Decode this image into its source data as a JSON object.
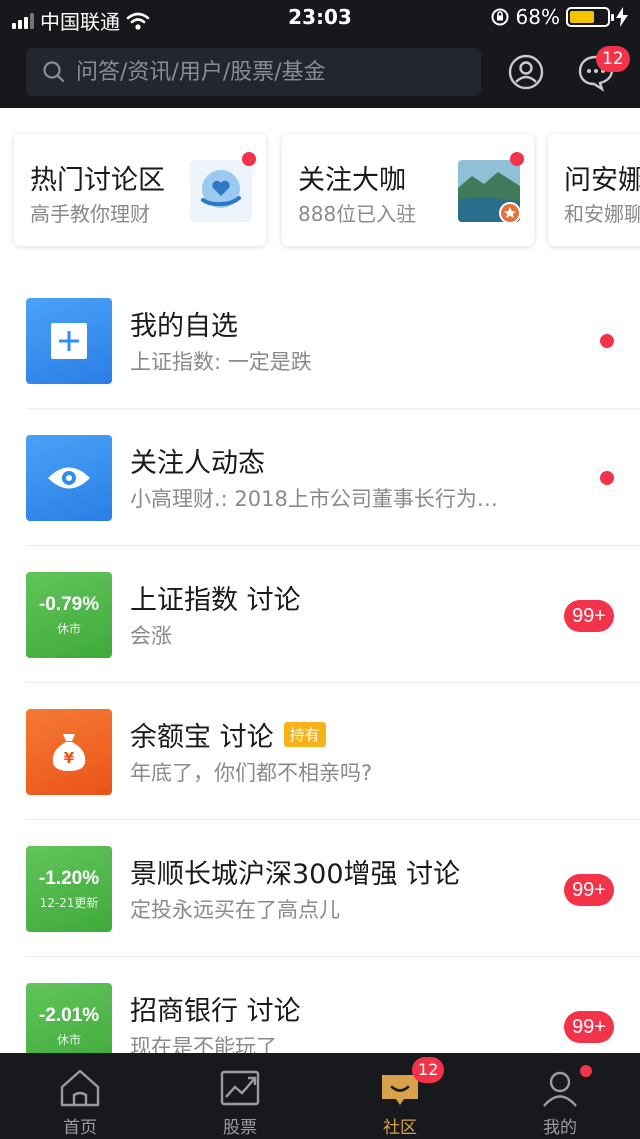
{
  "status_bar": {
    "carrier": "中国联通",
    "time": "23:03",
    "battery": "68%"
  },
  "search": {
    "placeholder": "问答/资讯/用户/股票/基金"
  },
  "header": {
    "message_count": "12"
  },
  "cards": [
    {
      "title": "热门讨论区",
      "subtitle": "高手教你理财"
    },
    {
      "title": "关注大咖",
      "subtitle": "888位已入驻"
    },
    {
      "title": "问安娜",
      "subtitle": "和安娜聊"
    }
  ],
  "list": [
    {
      "title": "我的自选",
      "subtitle": "上证指数: 一定是跌",
      "icon": "plus-icon"
    },
    {
      "title": "关注人动态",
      "subtitle": "小高理财.: 2018上市公司董事长行为…",
      "icon": "eye-icon"
    },
    {
      "title": "上证指数 讨论",
      "subtitle": "会涨",
      "pct": "-0.79%",
      "pct_sub": "休市",
      "count": "99+"
    },
    {
      "title": "余额宝 讨论",
      "tag": "持有",
      "subtitle": "年底了，你们都不相亲吗?",
      "icon": "money-bag-icon"
    },
    {
      "title": "景顺长城沪深300增强 讨论",
      "subtitle": "定投永远买在了高点儿",
      "pct": "-1.20%",
      "pct_sub": "12-21更新",
      "count": "99+"
    },
    {
      "title": "招商银行 讨论",
      "subtitle": "现在是不能玩了",
      "pct": "-2.01%",
      "pct_sub": "休市",
      "count": "99+"
    }
  ],
  "tabbar": {
    "tabs": [
      {
        "label": "首页"
      },
      {
        "label": "股票"
      },
      {
        "label": "社区",
        "badge": "12"
      },
      {
        "label": "我的"
      }
    ]
  },
  "colors": {
    "header_bg": "#16181c",
    "accent_red": "#f2334a",
    "tile_blue": "#2f8ef0",
    "tile_green": "#4cb84a",
    "tile_orange": "#f0621d",
    "tab_active": "#d8a24a"
  }
}
